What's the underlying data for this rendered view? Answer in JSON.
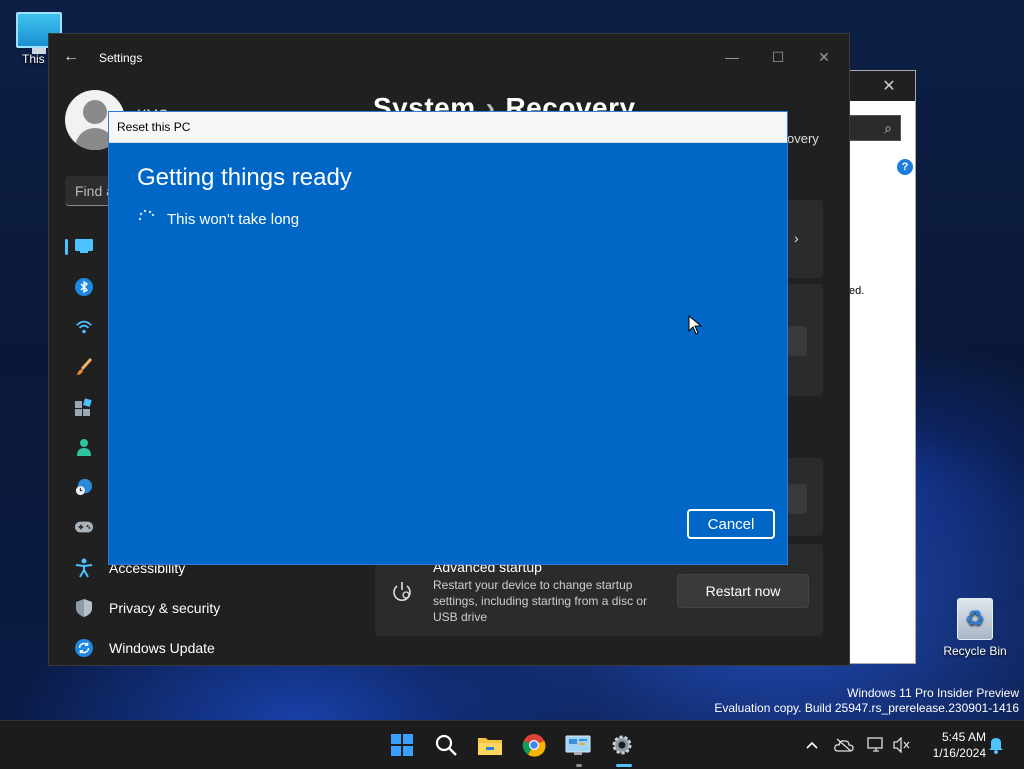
{
  "desktop": {
    "this_pc_label": "This P",
    "recycle_bin_label": "Recycle Bin",
    "watermark_line1": "Windows 11 Pro Insider Preview",
    "watermark_line2": "Evaluation copy. Build 25947.rs_prerelease.230901-1416"
  },
  "back_window": {
    "close_glyph": "✕",
    "search_glyph": "⌕",
    "help_glyph": "?",
    "text_fragment": "ed."
  },
  "settings": {
    "title": "Settings",
    "user_name": "XMC",
    "search_placeholder": "Find a",
    "breadcrumb_parent": "System",
    "breadcrumb_sep": "›",
    "breadcrumb_current": "Recovery",
    "side_fragment": "overy",
    "nav_items": [
      {
        "label": "Accessibility"
      },
      {
        "label": "Privacy & security"
      },
      {
        "label": "Windows Update"
      }
    ],
    "advanced_startup": {
      "title": "Advanced startup",
      "description": "Restart your device to change startup settings, including starting from a disc or USB drive",
      "button": "Restart now"
    }
  },
  "reset_dialog": {
    "title": "Reset this PC",
    "heading": "Getting things ready",
    "subtext": "This won't take long",
    "cancel_label": "Cancel"
  },
  "taskbar": {
    "time": "5:45 AM",
    "date": "1/16/2024"
  },
  "colors": {
    "dialog_blue": "#0067c7",
    "accent": "#4cc2ff"
  }
}
